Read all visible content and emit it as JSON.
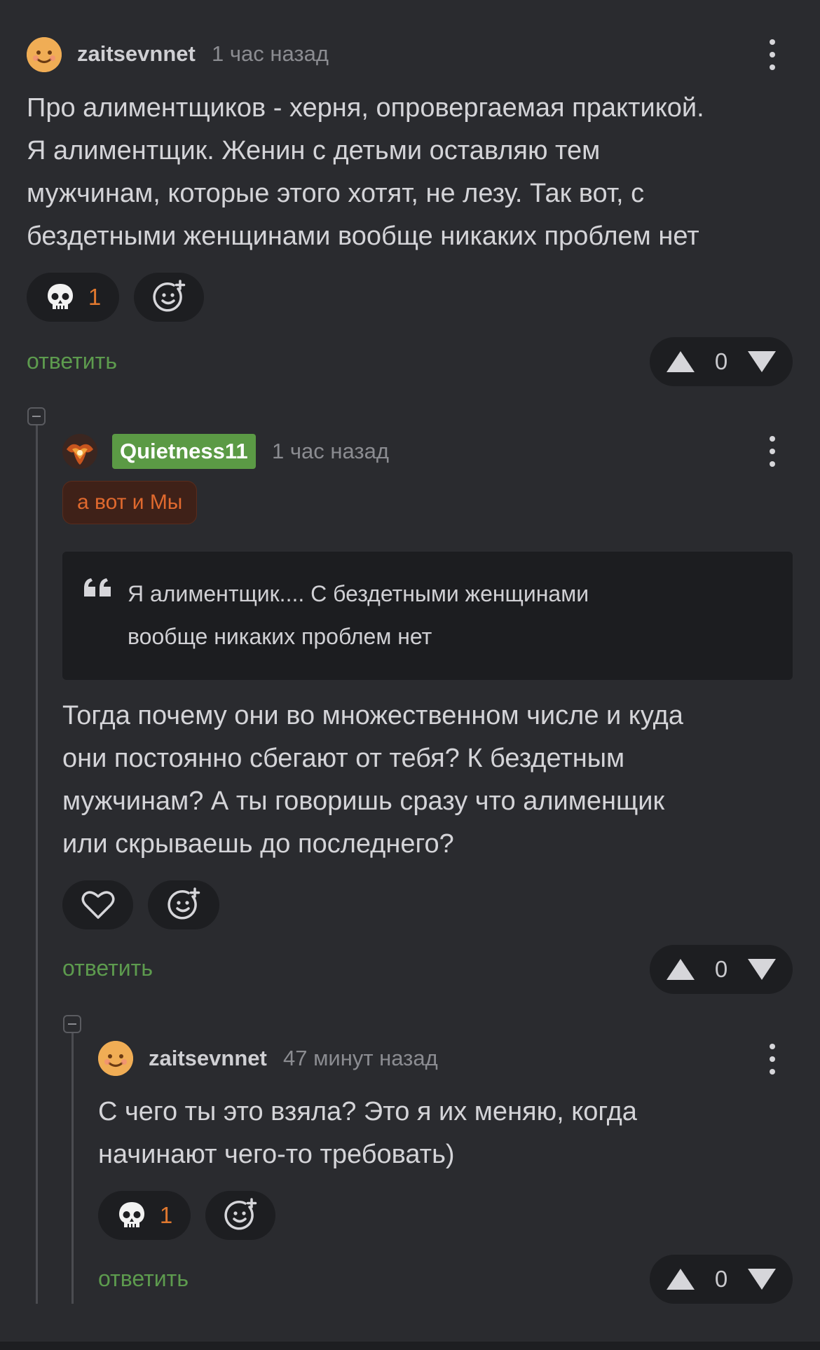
{
  "comments": [
    {
      "username": "zaitsevnnet",
      "time": "1 час назад",
      "text": "Про алиментщиков - херня, опровергаемая практикой.\nЯ алиментщик. Женин с детьми оставляю тем\nмужчинам, которые этого хотят, не лезу. Так вот, с\nбездетными женщинами вообще никаких проблем нет",
      "reaction": {
        "icon": "skull-icon",
        "count": "1"
      },
      "reply_label": "ответить",
      "rating": "0"
    },
    {
      "username": "Quietness11",
      "time": "1 час назад",
      "tag": "а вот и Мы",
      "quote": "Я алиментщик.... С бездетными женщинами\nвообще никаких проблем нет",
      "text": "Тогда почему они во множественном числе и куда\nони постоянно сбегают от тебя? К бездетным\nмужчинам? А ты говоришь сразу что алименщик\nили скрываешь до последнего?",
      "reaction": {
        "icon": "heart-icon"
      },
      "reply_label": "ответить",
      "rating": "0"
    },
    {
      "username": "zaitsevnnet",
      "time": "47 минут назад",
      "text": "С чего ты это взяла? Это я их меняю, когда\nначинают чего-то требовать)",
      "reaction": {
        "icon": "skull-icon",
        "count": "1"
      },
      "reply_label": "ответить",
      "rating": "0"
    }
  ],
  "colors": {
    "background": "#2a2b2f",
    "reply": "#5d9b4e",
    "count": "#e0782f",
    "badge": "#5b9a45",
    "tag": "#e0692e"
  }
}
